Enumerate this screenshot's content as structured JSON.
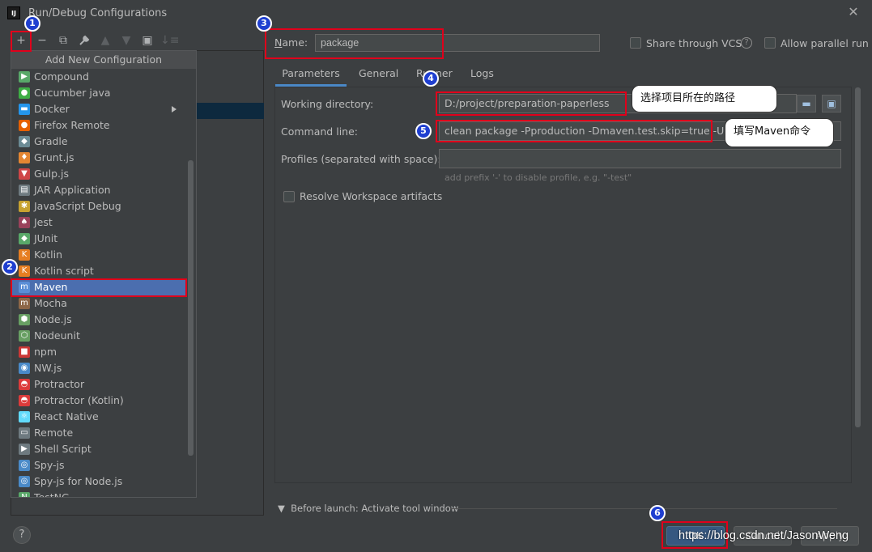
{
  "window": {
    "title": "Run/Debug Configurations",
    "icon_text": "IJ"
  },
  "toolbar": {
    "add": "+",
    "remove": "−",
    "copy": "⧉",
    "wrench": "🔧",
    "up": "▲",
    "down": "▼",
    "folder": "▣",
    "sort": "↓≡"
  },
  "popup": {
    "title": "Add New Configuration",
    "items": [
      {
        "label": "Compound",
        "icon": "compound-icon",
        "color": "#59a869",
        "glyph": "▶"
      },
      {
        "label": "Cucumber java",
        "icon": "cucumber-icon",
        "color": "#3eae45",
        "glyph": "●"
      },
      {
        "label": "Docker",
        "icon": "docker-icon",
        "color": "#2496ed",
        "glyph": "▬",
        "submenu": true
      },
      {
        "label": "Firefox Remote",
        "icon": "firefox-icon",
        "color": "#e66000",
        "glyph": "●"
      },
      {
        "label": "Gradle",
        "icon": "gradle-icon",
        "color": "#6c8b95",
        "glyph": "◆"
      },
      {
        "label": "Grunt.js",
        "icon": "grunt-icon",
        "color": "#e48632",
        "glyph": "♦"
      },
      {
        "label": "Gulp.js",
        "icon": "gulp-icon",
        "color": "#cf4647",
        "glyph": "▼"
      },
      {
        "label": "JAR Application",
        "icon": "jar-icon",
        "color": "#6e7a80",
        "glyph": "▤"
      },
      {
        "label": "JavaScript Debug",
        "icon": "js-debug-icon",
        "color": "#c7a230",
        "glyph": "✱"
      },
      {
        "label": "Jest",
        "icon": "jest-icon",
        "color": "#99425b",
        "glyph": "♠"
      },
      {
        "label": "JUnit",
        "icon": "junit-icon",
        "color": "#59a869",
        "glyph": "◆"
      },
      {
        "label": "Kotlin",
        "icon": "kotlin-icon",
        "color": "#e67e22",
        "glyph": "K"
      },
      {
        "label": "Kotlin script",
        "icon": "kotlin-script-icon",
        "color": "#e67e22",
        "glyph": "K"
      },
      {
        "label": "Maven",
        "icon": "maven-icon",
        "color": "#5a8ed6",
        "glyph": "m",
        "selected": true
      },
      {
        "label": "Mocha",
        "icon": "mocha-icon",
        "color": "#8d6748",
        "glyph": "m"
      },
      {
        "label": "Node.js",
        "icon": "nodejs-icon",
        "color": "#689f63",
        "glyph": "⬢"
      },
      {
        "label": "Nodeunit",
        "icon": "nodeunit-icon",
        "color": "#689f63",
        "glyph": "⬡"
      },
      {
        "label": "npm",
        "icon": "npm-icon",
        "color": "#cb3837",
        "glyph": "■"
      },
      {
        "label": "NW.js",
        "icon": "nwjs-icon",
        "color": "#4a8ac8",
        "glyph": "◉"
      },
      {
        "label": "Protractor",
        "icon": "protractor-icon",
        "color": "#dc3b3b",
        "glyph": "◓"
      },
      {
        "label": "Protractor (Kotlin)",
        "icon": "protractor-kotlin-icon",
        "color": "#dc3b3b",
        "glyph": "◓"
      },
      {
        "label": "React Native",
        "icon": "react-icon",
        "color": "#61dafb",
        "glyph": "⚛"
      },
      {
        "label": "Remote",
        "icon": "remote-icon",
        "color": "#6e7a80",
        "glyph": "▭"
      },
      {
        "label": "Shell Script",
        "icon": "shell-icon",
        "color": "#6e7a80",
        "glyph": "▶"
      },
      {
        "label": "Spy-js",
        "icon": "spyjs-icon",
        "color": "#4a8ac8",
        "glyph": "◎"
      },
      {
        "label": "Spy-js for Node.js",
        "icon": "spyjs-node-icon",
        "color": "#4a8ac8",
        "glyph": "◎"
      },
      {
        "label": "TestNG",
        "icon": "testng-icon",
        "color": "#59a869",
        "glyph": "N"
      }
    ]
  },
  "form": {
    "name_label": "Name:",
    "name_value": "package",
    "share_vcs": "Share through VCS",
    "allow_parallel": "Allow parallel run",
    "tabs": [
      "Parameters",
      "General",
      "Runner",
      "Logs"
    ],
    "working_dir_label": "Working directory:",
    "working_dir_value": "D:/project/preparation-paperless",
    "command_line_label": "Command line:",
    "command_line_value": "clean package -Pproduction -Dmaven.test.skip=true -U",
    "profiles_label": "Profiles (separated with space):",
    "profiles_value": "",
    "profiles_hint": "add prefix '-' to disable profile, e.g. \"-test\"",
    "resolve_workspace": "Resolve Workspace artifacts",
    "before_launch": "Before launch: Activate tool window"
  },
  "buttons": {
    "ok": "OK",
    "cancel": "Cancel",
    "apply": "Apply",
    "help": "?"
  },
  "annotations": {
    "badges": [
      "1",
      "2",
      "3",
      "4",
      "5",
      "6"
    ],
    "callout_dir": "选择项目所在的路径",
    "callout_cmd": "填写Maven命令",
    "watermark": "https://blog.csdn.net/JasonWeng"
  }
}
